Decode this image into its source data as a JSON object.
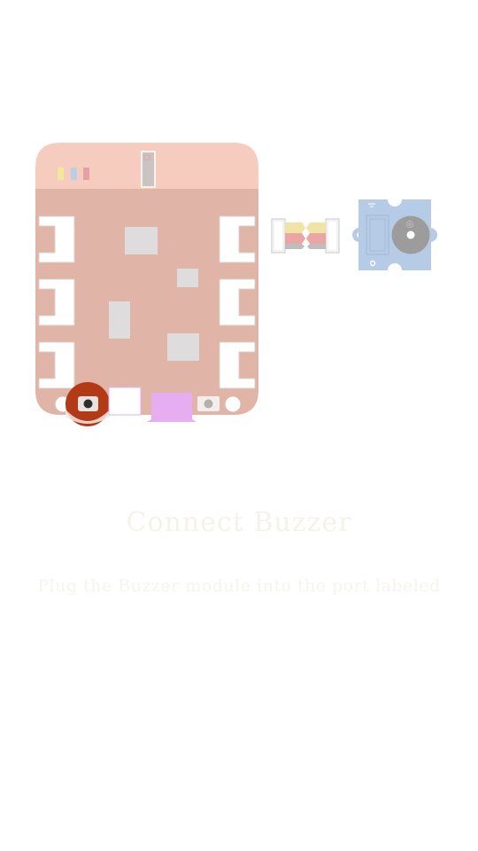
{
  "caption": {
    "title": "Connect Buzzer",
    "subtitle": "Plug the Buzzer module into the port labeled"
  },
  "colors": {
    "board_top": "#f6ccbf",
    "board_body": "#e0b4a6",
    "chip": "#dedcdc",
    "port_fill": "#ffffff",
    "port_stroke": "#d9d0cc",
    "led_yellow": "#f3e79a",
    "led_blue": "#b9cfe8",
    "led_red": "#e3a3a6",
    "button_red": "#b33a17",
    "usb_purple": "#e6aef1",
    "cable_yellow": "#efe3a6",
    "cable_red": "#eba5a4",
    "cable_gray": "#bdbdbd",
    "buzzer_board": "#b6cce6",
    "buzzer_disc": "#9c9c9c"
  },
  "icons": [
    "mounting-hole-icon",
    "reset-button-icon",
    "led-icon",
    "buzzer-icon"
  ]
}
